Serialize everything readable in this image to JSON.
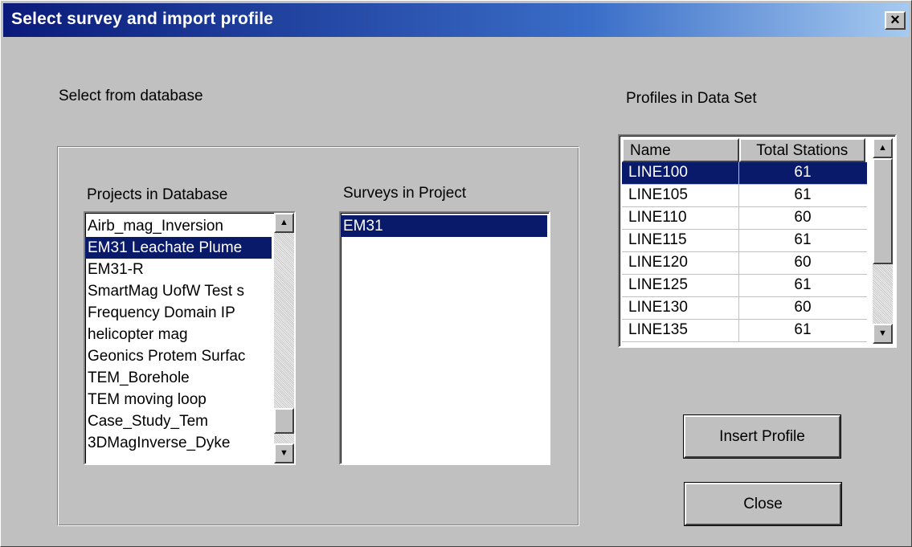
{
  "window": {
    "title": "Select survey and import profile",
    "close_glyph": "×"
  },
  "labels": {
    "select_from_database": "Select from database",
    "projects_in_database": "Projects in Database",
    "surveys_in_project": "Surveys in Project",
    "profiles_in_data_set": "Profiles in Data Set"
  },
  "projects": {
    "items": [
      "Airb_mag_Inversion",
      "EM31 Leachate Plume",
      "EM31-R",
      "SmartMag UofW Test s",
      "Frequency Domain IP",
      "helicopter mag",
      "Geonics Protem Surfac",
      "TEM_Borehole",
      "TEM moving loop",
      "Case_Study_Tem",
      "3DMagInverse_Dyke"
    ],
    "selected_index": 1
  },
  "surveys": {
    "items": [
      "EM31"
    ],
    "selected_index": 0
  },
  "profiles": {
    "columns": [
      "Name",
      "Total Stations"
    ],
    "rows": [
      {
        "name": "LINE100",
        "stations": "61"
      },
      {
        "name": "LINE105",
        "stations": "61"
      },
      {
        "name": "LINE110",
        "stations": "60"
      },
      {
        "name": "LINE115",
        "stations": "61"
      },
      {
        "name": "LINE120",
        "stations": "60"
      },
      {
        "name": "LINE125",
        "stations": "61"
      },
      {
        "name": "LINE130",
        "stations": "60"
      },
      {
        "name": "LINE135",
        "stations": "61"
      }
    ],
    "selected_index": 0
  },
  "buttons": {
    "insert_profile": "Insert Profile",
    "close": "Close"
  },
  "icons": {
    "scroll_up": "▲",
    "scroll_down": "▼"
  },
  "colors": {
    "selection": "#0a1a6a",
    "title_start": "#0a1a7a",
    "title_end": "#a6caf0",
    "face": "#c0c0c0"
  }
}
